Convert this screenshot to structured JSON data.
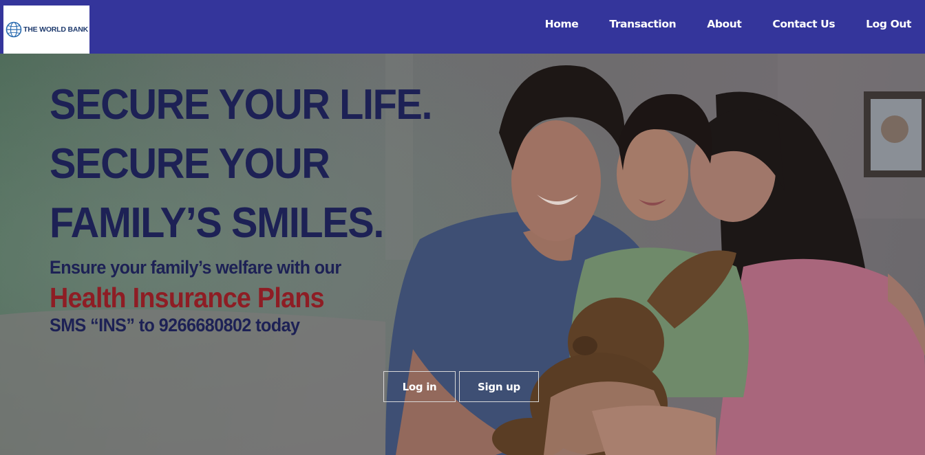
{
  "brand": {
    "logo_text": "THE WORLD BANK",
    "logo_icon": "globe-icon"
  },
  "nav": {
    "items": [
      {
        "label": "Home"
      },
      {
        "label": "Transaction"
      },
      {
        "label": "About"
      },
      {
        "label": "Contact Us"
      },
      {
        "label": "Log Out"
      }
    ]
  },
  "hero": {
    "headline": [
      "SECURE YOUR LIFE.",
      "SECURE YOUR",
      "FAMILY’S SMILES."
    ],
    "tagline": "Ensure your family’s welfare with our",
    "highlight": "Health Insurance Plans",
    "sms_text": "SMS “INS” to 9266680802 today",
    "login_label": "Log in",
    "signup_label": "Sign up"
  },
  "colors": {
    "navbar_bg": "#34359b",
    "headline": "#1d2155",
    "highlight": "#8e1d24",
    "button_border": "#d9d9d9"
  }
}
